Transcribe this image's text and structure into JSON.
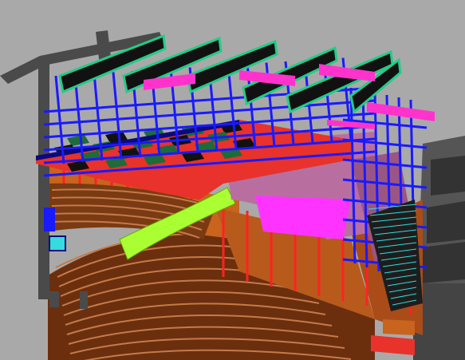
{
  "viewport": {
    "background": "#a9a9a9"
  },
  "palette": {
    "concrete": "#4a4a4a",
    "concrete_light": "#6e6e6e",
    "steel_blue": "#1a1aff",
    "truss_green": "#22cc88",
    "beam_magenta": "#ff33cc",
    "slab_red": "#e8322b",
    "slab_green": "#1f6b3a",
    "wall_orange": "#c8641e",
    "wall_tan": "#b85a1c",
    "seat_brown": "#7a3a12",
    "seat_light": "#c47a4a",
    "balcony_lime": "#aaff33",
    "mauve": "#b86fa0",
    "cyan": "#33dddd"
  }
}
